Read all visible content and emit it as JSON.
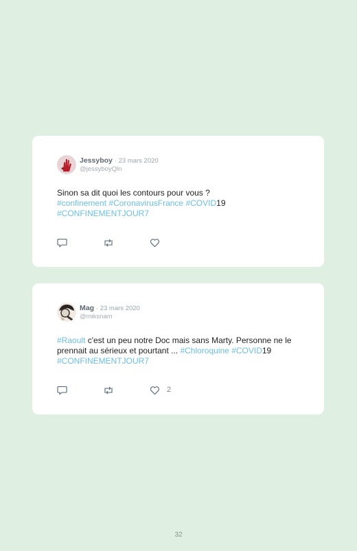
{
  "tweets": [
    {
      "author": "Jessyboy",
      "date": "· 23 mars 2020",
      "handle": "@jessyboyQln",
      "text_plain": "Sinon sa dit quoi les contours pour vous ?",
      "line2": [
        "#confinement",
        "#CoronavirusFrance",
        "#COVID",
        "19"
      ],
      "line3": [
        "#CONFINEMENTJOUR7"
      ],
      "likes": ""
    },
    {
      "author": "Mag",
      "date": "· 23 mars 2020",
      "handle": "@miksnam",
      "tag_raoult": "#Raoult",
      "text_a": " c'est un peu notre Doc mais sans Marty. Personne ne le prennait au sérieux et pourtant ... ",
      "tag_chloro": "#Chloroquine",
      "tag_covid": "#COVID",
      "covid_suffix": "19",
      "tag_jour7": "#CONFINEMENTJOUR7",
      "likes": "2"
    }
  ],
  "page_number": "32",
  "colors": {
    "background": "#dff0e2",
    "hashtag": "#6bc0e4",
    "card": "#ffffff"
  },
  "icons": [
    "reply-icon",
    "retweet-icon",
    "heart-icon"
  ]
}
